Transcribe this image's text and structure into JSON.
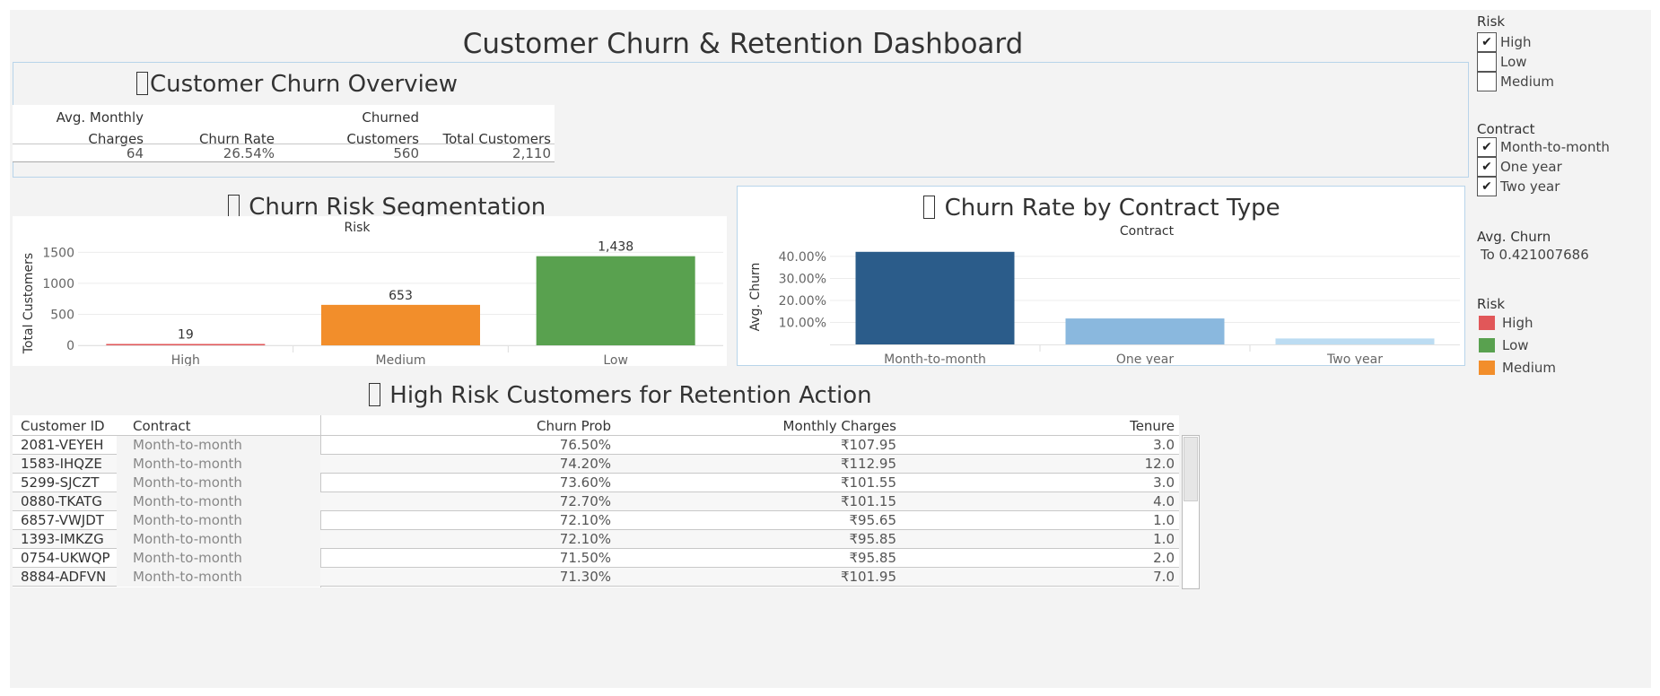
{
  "dashboard": {
    "title": "Customer Churn & Retention Dashboard"
  },
  "overview": {
    "title": "Customer Churn Overview",
    "headers": {
      "avg_monthly_1": "Avg. Monthly",
      "avg_monthly_2": "Charges",
      "churn_rate": "Churn Rate",
      "churned_1": "Churned",
      "churned_2": "Customers",
      "total": "Total Customers"
    },
    "values": {
      "avg_monthly": "64",
      "churn_rate": "26.54%",
      "churned": "560",
      "total": "2,110"
    }
  },
  "segmentation": {
    "title": "Churn Risk Segmentation",
    "chart_data": {
      "type": "bar",
      "title": "Risk",
      "ylabel": "Total Customers",
      "categories": [
        "High",
        "Medium",
        "Low"
      ],
      "values": [
        19,
        653,
        1438
      ],
      "value_labels": [
        "19",
        "653",
        "1,438"
      ],
      "colors": [
        "#e15759",
        "#f28e2b",
        "#59a14f"
      ],
      "ylim": [
        0,
        1650
      ],
      "yticks": [
        0,
        500,
        1000,
        1500
      ],
      "ytick_labels": [
        "0",
        "500",
        "1000",
        "1500"
      ],
      "grid": true
    }
  },
  "contract_chart": {
    "title": "Churn Rate by Contract Type",
    "chart_data": {
      "type": "bar",
      "title": "Contract",
      "ylabel": "Avg. Churn",
      "categories": [
        "Month-to-month",
        "One year",
        "Two year"
      ],
      "values": [
        0.421,
        0.118,
        0.027
      ],
      "colors": [
        "#2b5c8a",
        "#8ab8de",
        "#bcdcf2"
      ],
      "ylim": [
        0,
        0.465
      ],
      "yticks": [
        0.1,
        0.2,
        0.3,
        0.4
      ],
      "ytick_labels": [
        "10.00%",
        "20.00%",
        "30.00%",
        "40.00%"
      ],
      "grid": true
    }
  },
  "high_risk": {
    "title": "High Risk Customers for Retention Action",
    "columns": [
      "Customer ID",
      "Contract",
      "Churn Prob",
      "Monthly Charges",
      "Tenure"
    ],
    "rows": [
      [
        "2081-VEYEH",
        "Month-to-month",
        "76.50%",
        "₹107.95",
        "3.0"
      ],
      [
        "1583-IHQZE",
        "Month-to-month",
        "74.20%",
        "₹112.95",
        "12.0"
      ],
      [
        "5299-SJCZT",
        "Month-to-month",
        "73.60%",
        "₹101.55",
        "3.0"
      ],
      [
        "0880-TKATG",
        "Month-to-month",
        "72.70%",
        "₹101.15",
        "4.0"
      ],
      [
        "6857-VWJDT",
        "Month-to-month",
        "72.10%",
        "₹95.65",
        "1.0"
      ],
      [
        "1393-IMKZG",
        "Month-to-month",
        "72.10%",
        "₹95.85",
        "1.0"
      ],
      [
        "0754-UKWQP",
        "Month-to-month",
        "71.50%",
        "₹95.85",
        "2.0"
      ],
      [
        "8884-ADFVN",
        "Month-to-month",
        "71.30%",
        "₹101.95",
        "7.0"
      ]
    ]
  },
  "filters": {
    "risk": {
      "title": "Risk",
      "items": [
        {
          "label": "High",
          "checked": true
        },
        {
          "label": "Low",
          "checked": false
        },
        {
          "label": "Medium",
          "checked": false
        }
      ]
    },
    "contract": {
      "title": "Contract",
      "items": [
        {
          "label": "Month-to-month",
          "checked": true
        },
        {
          "label": "One year",
          "checked": true
        },
        {
          "label": "Two year",
          "checked": true
        }
      ]
    },
    "avg_churn": {
      "title": "Avg. Churn",
      "value": "To 0.421007686"
    },
    "risk_legend": {
      "title": "Risk",
      "items": [
        {
          "label": "High",
          "color": "#e15759"
        },
        {
          "label": "Low",
          "color": "#59a14f"
        },
        {
          "label": "Medium",
          "color": "#f28e2b"
        }
      ]
    }
  }
}
